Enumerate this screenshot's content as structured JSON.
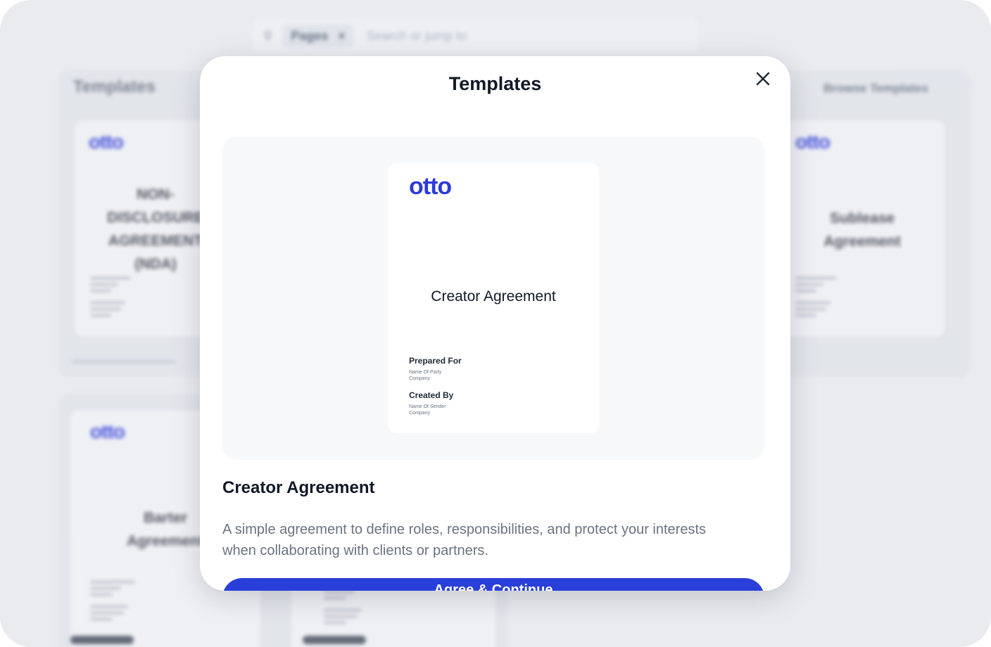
{
  "background": {
    "search": {
      "chip_label": "Pages",
      "chip_close": "×",
      "placeholder": "Search or jump to"
    },
    "section_title": "Templates",
    "browse_link": "Browse Templates",
    "cards": [
      {
        "logo": "otto",
        "title": "NON-DISCLOSURE AGREEMENT (NDA)"
      },
      {
        "logo": "otto",
        "title": "Sublease Agreement"
      },
      {
        "logo": "otto",
        "title": "Barter Agreement"
      }
    ]
  },
  "modal": {
    "title": "Templates",
    "close_icon": "close-icon",
    "preview": {
      "logo": "otto",
      "doc_title": "Creator Agreement",
      "prepared_for_label": "Prepared For",
      "prepared_for_name": "Name Of Party",
      "prepared_for_company": "Company",
      "created_by_label": "Created By",
      "created_by_name": "Name Of Sender",
      "created_by_company": "Company"
    },
    "template_name": "Creator Agreement",
    "description": "A simple agreement to define roles, responsibilities, and protect your interests when collaborating with clients or partners.",
    "cta_label": "Agree & Continue"
  },
  "colors": {
    "brand": "#2d3bd8",
    "cta": "#2a3fd9",
    "overlay": "#e9ebef"
  }
}
